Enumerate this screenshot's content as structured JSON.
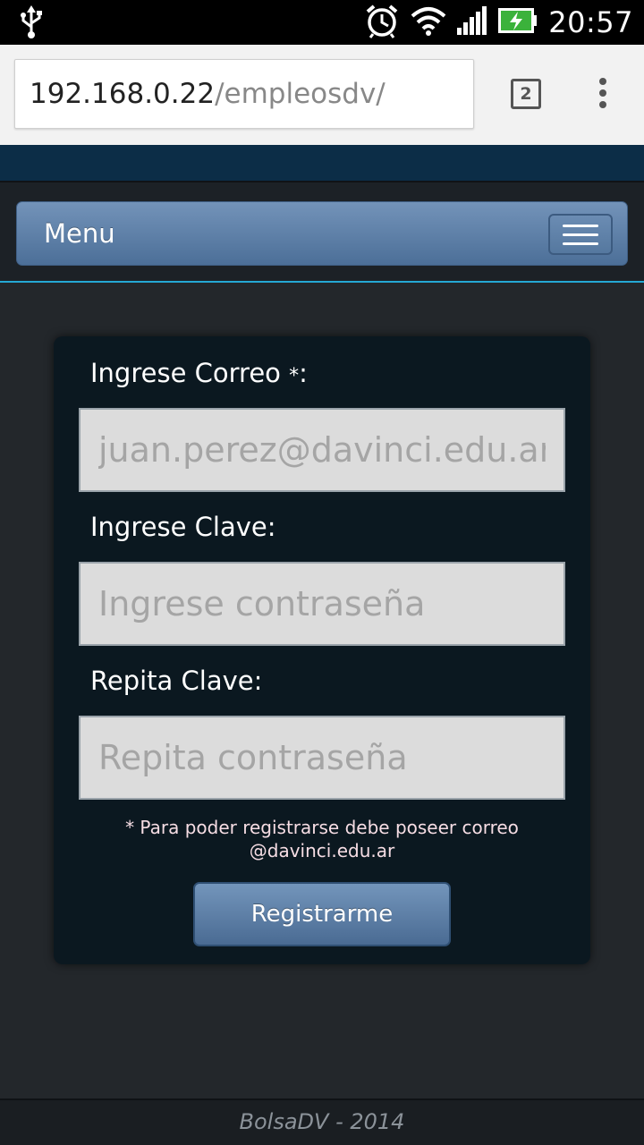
{
  "status_bar": {
    "time": "20:57",
    "icons": [
      "usb-icon",
      "alarm-icon",
      "wifi-icon",
      "signal-icon",
      "battery-charging-icon"
    ]
  },
  "browser": {
    "url_host": "192.168.0.22",
    "url_path": "/empleosdv/",
    "tab_count": "2",
    "icons": [
      "tabs-icon",
      "more-vert-icon"
    ]
  },
  "navbar": {
    "menu_label": "Menu",
    "toggle_icon": "hamburger-icon"
  },
  "form": {
    "email_label": "Ingrese Correo ",
    "email_required_mark": "*",
    "email_label_suffix": ":",
    "email_placeholder": "juan.perez@davinci.edu.ar",
    "password_label": "Ingrese Clave:",
    "password_placeholder": "Ingrese contraseña",
    "repeat_label": "Repita Clave:",
    "repeat_placeholder": "Repita contraseña",
    "note_line1": "* Para poder registrarse debe poseer correo",
    "note_line2": "@davinci.edu.ar",
    "submit_label": "Registrarme"
  },
  "footer": {
    "text": "BolsaDV - 2014"
  },
  "colors": {
    "page_bg": "#23272b",
    "header_band": "#0c2d47",
    "navbar": "#5f82ab",
    "accent_line": "#25a8d4",
    "card_bg": "#0b1820"
  }
}
